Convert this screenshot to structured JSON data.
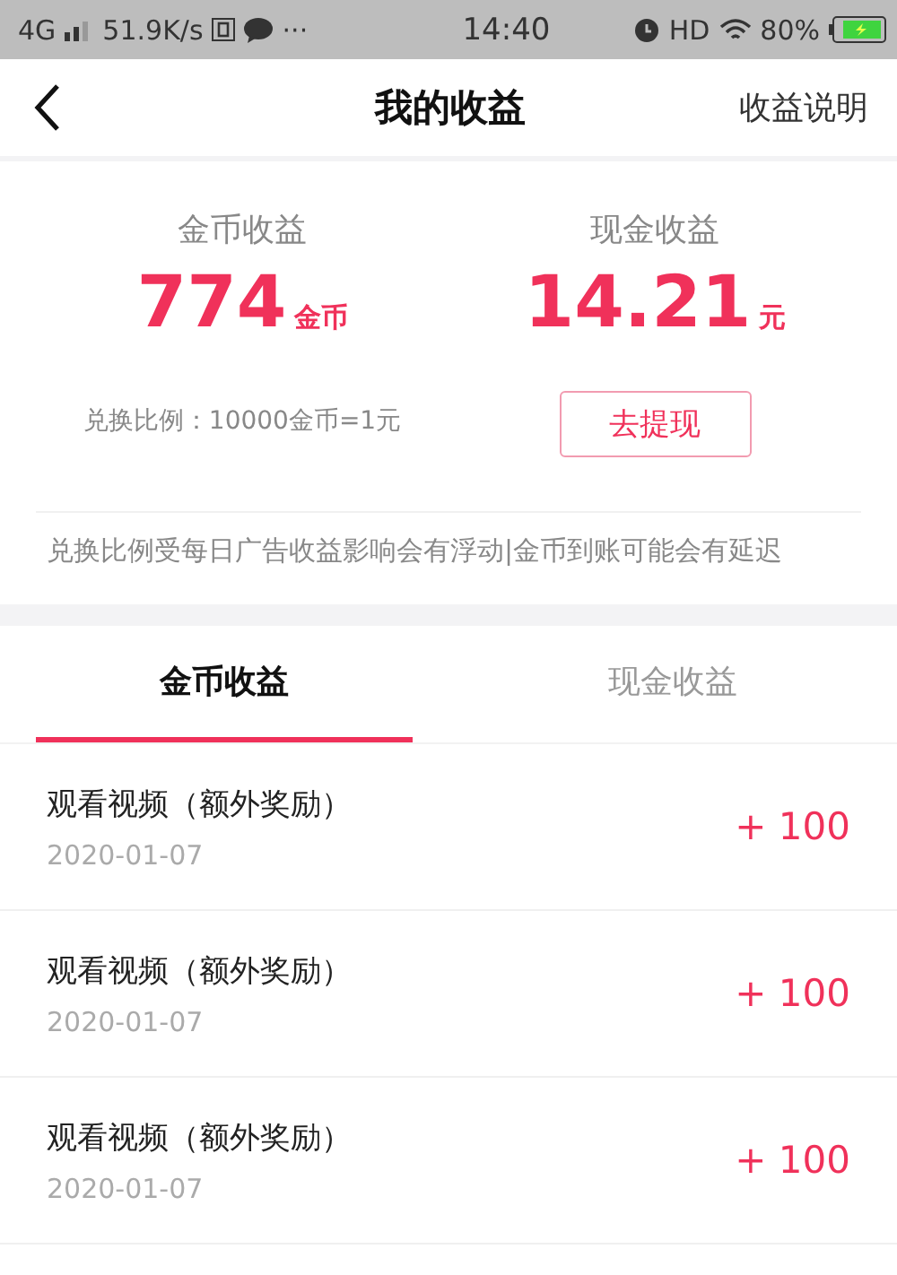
{
  "status_bar": {
    "network": "4G",
    "speed": "51.9K/s",
    "more": "···",
    "time": "14:40",
    "hd": "HD",
    "battery": "80%"
  },
  "nav": {
    "title": "我的收益",
    "action": "收益说明"
  },
  "summary": [
    {
      "label": "金币收益",
      "amount": "774",
      "unit": "金币",
      "note": "兑换比例：10000金币=1元",
      "kind": "note"
    },
    {
      "label": "现金收益",
      "amount": "14.21",
      "unit": "元",
      "button": "去提现",
      "kind": "button"
    }
  ],
  "notice": "兑换比例受每日广告收益影响会有浮动|金币到账可能会有延迟",
  "tabs": [
    {
      "label": "金币收益",
      "selected": true
    },
    {
      "label": "现金收益",
      "selected": false
    }
  ],
  "records": [
    {
      "title": "观看视频（额外奖励）",
      "date": "2020-01-07",
      "amount": "+ 100"
    },
    {
      "title": "观看视频（额外奖励）",
      "date": "2020-01-07",
      "amount": "+ 100"
    },
    {
      "title": "观看视频（额外奖励）",
      "date": "2020-01-07",
      "amount": "+ 100"
    }
  ]
}
